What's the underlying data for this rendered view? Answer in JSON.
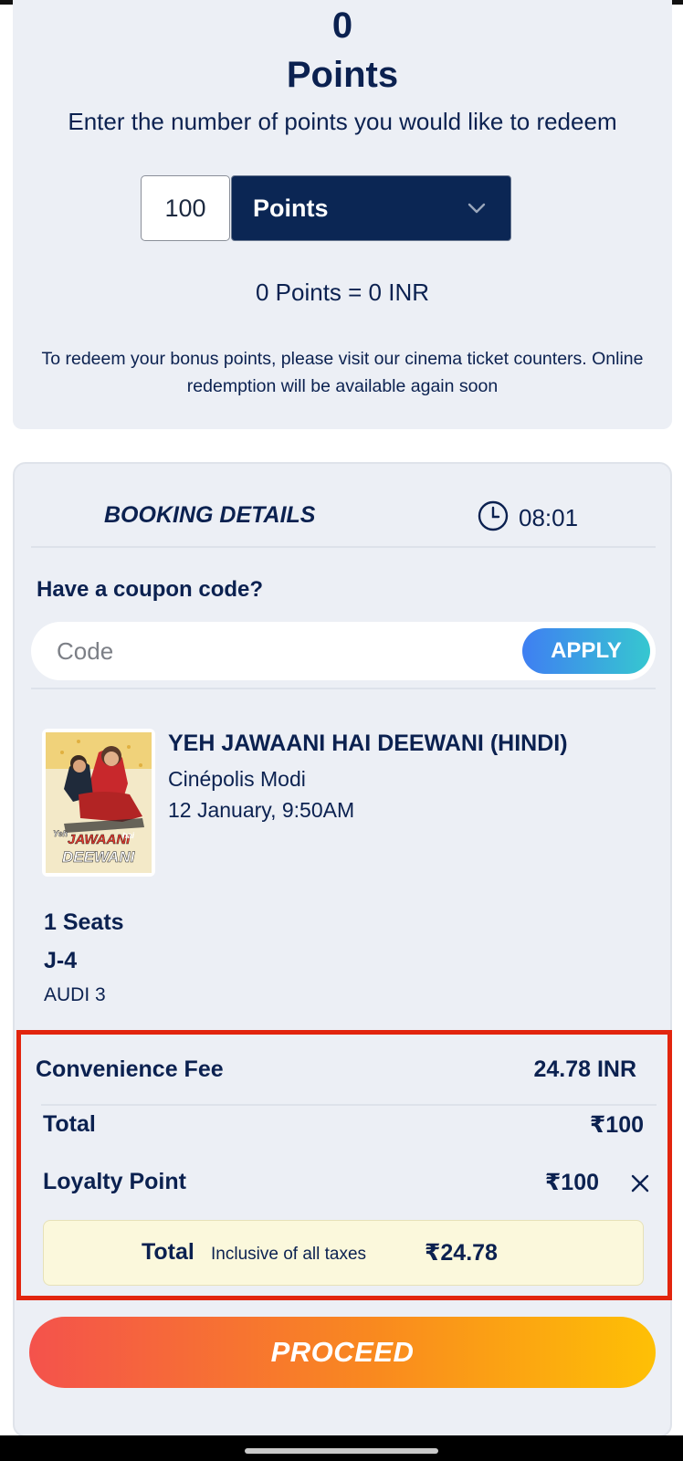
{
  "points": {
    "count": "0",
    "unit_label": "Points",
    "instruction": "Enter the number of points you would like to redeem",
    "input_value": "100",
    "select_label": "Points",
    "conversion": "0 Points = 0 INR",
    "note": "To redeem your bonus points, please visit our cinema ticket counters. Online redemption will be available again soon"
  },
  "booking": {
    "title": "BOOKING DETAILS",
    "timer": "08:01",
    "coupon_label": "Have a coupon code?",
    "coupon_placeholder": "Code",
    "apply_label": "APPLY"
  },
  "movie": {
    "title": "YEH JAWAANI HAI DEEWANI (HINDI)",
    "cinema": "Cinépolis Modi",
    "datetime": "12 January, 9:50AM",
    "poster_text": "YEH JAWAANI hai DEEWANI"
  },
  "seats": {
    "count_label": "1 Seats",
    "seat_id": "J-4",
    "auditorium": "AUDI 3"
  },
  "summary": {
    "fee_label": "Convenience Fee",
    "fee_value": "24.78 INR",
    "total_label": "Total",
    "total_value": "₹100",
    "loyalty_label": "Loyalty Point",
    "loyalty_value": "₹100",
    "grand_label": "Total",
    "grand_note": "Inclusive of all taxes",
    "grand_value": "₹24.78"
  },
  "proceed_label": "PROCEED",
  "colors": {
    "navy": "#0b2150",
    "panel_bg": "#eceff5",
    "highlight_red": "#e2250e",
    "apply_gradient_start": "#3f7ff2",
    "apply_gradient_end": "#36c7d0",
    "proceed_gradient_start": "#f4524c",
    "proceed_gradient_end": "#fec005"
  },
  "icons": {
    "select": "chevron-down-icon",
    "timer": "clock-icon",
    "remove_loyalty": "close-icon"
  }
}
